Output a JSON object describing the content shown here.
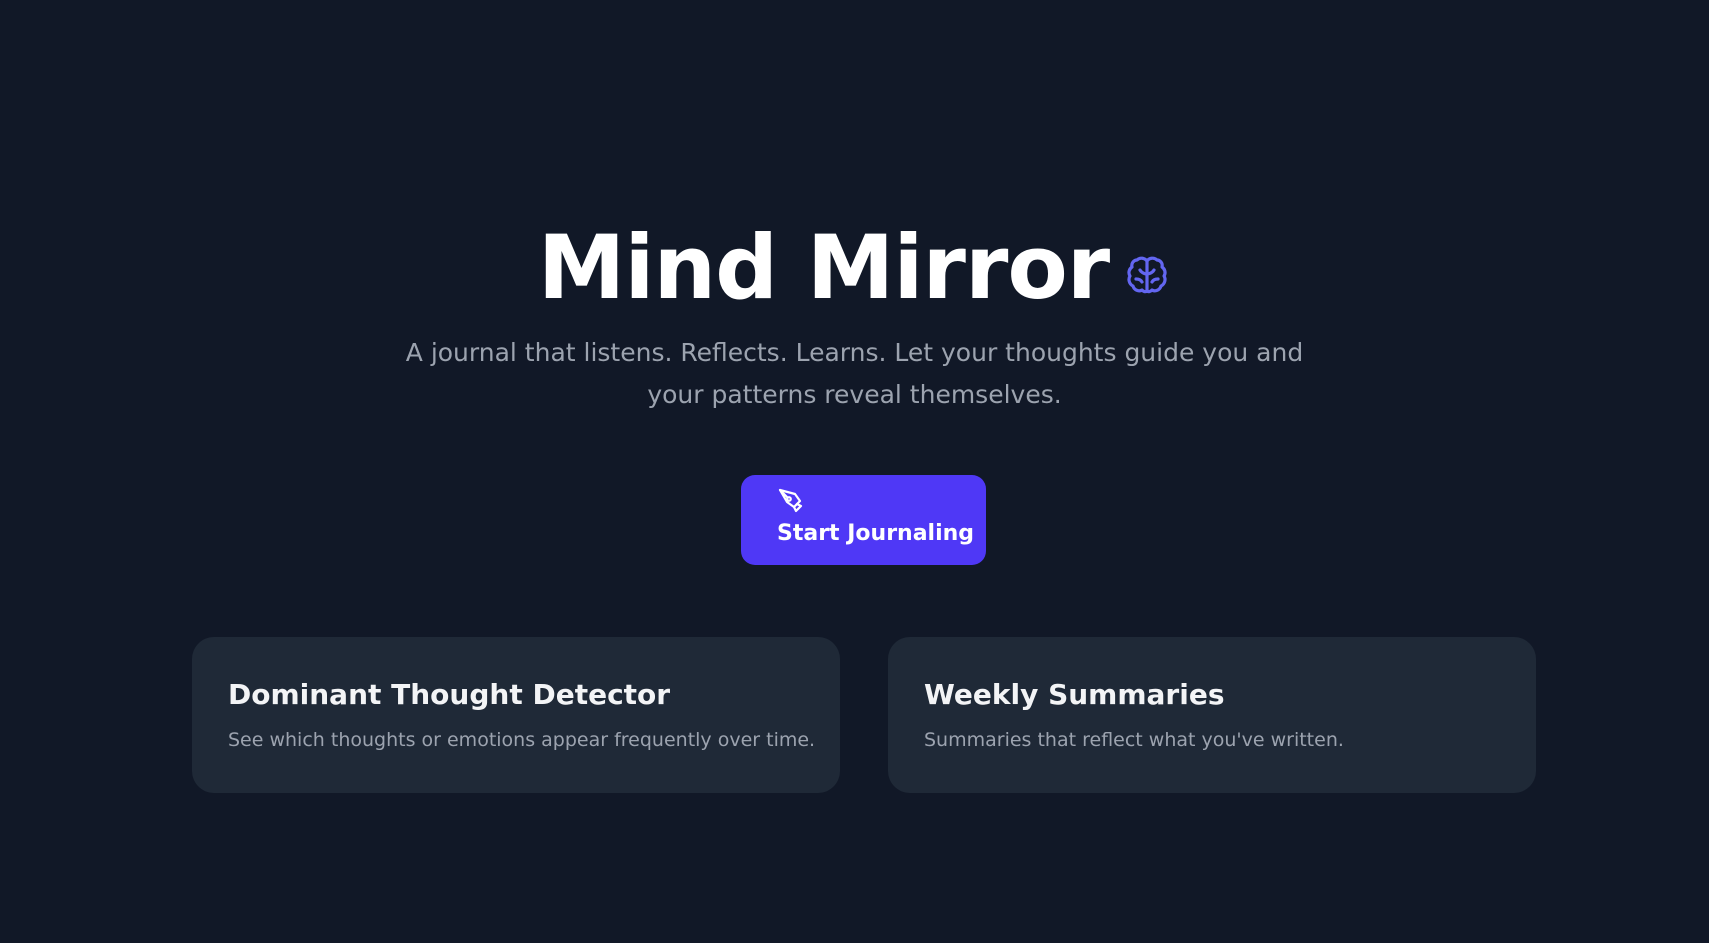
{
  "hero": {
    "title": "Mind Mirror",
    "title_icon": "brain-icon",
    "subtitle_line1": "A journal that listens. Reflects. Learns. Let your thoughts guide you and",
    "subtitle_line2": "your patterns reveal themselves."
  },
  "cta": {
    "label": "Start Journaling",
    "icon": "pen-nib-icon"
  },
  "features": [
    {
      "title": "Dominant Thought Detector",
      "description": "See which thoughts or emotions appear frequently over time."
    },
    {
      "title": "Weekly Summaries",
      "description": "Summaries that reflect what you've written."
    }
  ],
  "colors": {
    "background": "#111827",
    "accent": "#4f38f6",
    "icon_accent": "#6366f1",
    "card_background": "#1f2937",
    "muted_text": "#9ca3af"
  }
}
